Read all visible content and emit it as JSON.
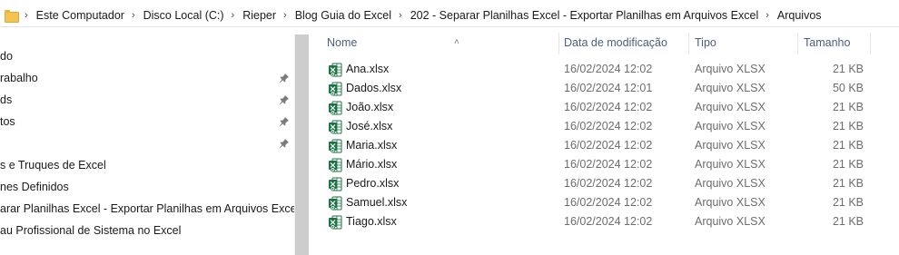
{
  "breadcrumb": [
    "Este Computador",
    "Disco Local (C:)",
    "Rieper",
    "Blog Guia do Excel",
    "202 - Separar Planilhas Excel - Exportar Planilhas em Arquivos Excel",
    "Arquivos"
  ],
  "nav": {
    "items": [
      {
        "label": "do",
        "pinned": false
      },
      {
        "label": "rabalho",
        "pinned": true
      },
      {
        "label": "ds",
        "pinned": true
      },
      {
        "label": "tos",
        "pinned": true
      },
      {
        "label": "",
        "pinned": true
      },
      {
        "label": "s e Truques de Excel",
        "pinned": false
      },
      {
        "label": "nes Definidos",
        "pinned": false
      },
      {
        "label": "arar Planilhas Excel - Exportar Planilhas em Arquivos Excel",
        "pinned": false
      },
      {
        "label": "au Profissional de Sistema no Excel",
        "pinned": false
      }
    ]
  },
  "columns": {
    "name": "Nome",
    "date": "Data de modificação",
    "type": "Tipo",
    "size": "Tamanho"
  },
  "files": [
    {
      "name": "Ana.xlsx",
      "date": "16/02/2024 12:02",
      "type": "Arquivo XLSX",
      "size": "21 KB"
    },
    {
      "name": "Dados.xlsx",
      "date": "16/02/2024 12:01",
      "type": "Arquivo XLSX",
      "size": "50 KB"
    },
    {
      "name": "João.xlsx",
      "date": "16/02/2024 12:02",
      "type": "Arquivo XLSX",
      "size": "21 KB"
    },
    {
      "name": "José.xlsx",
      "date": "16/02/2024 12:02",
      "type": "Arquivo XLSX",
      "size": "21 KB"
    },
    {
      "name": "Maria.xlsx",
      "date": "16/02/2024 12:02",
      "type": "Arquivo XLSX",
      "size": "21 KB"
    },
    {
      "name": "Mário.xlsx",
      "date": "16/02/2024 12:02",
      "type": "Arquivo XLSX",
      "size": "21 KB"
    },
    {
      "name": "Pedro.xlsx",
      "date": "16/02/2024 12:02",
      "type": "Arquivo XLSX",
      "size": "21 KB"
    },
    {
      "name": "Samuel.xlsx",
      "date": "16/02/2024 12:02",
      "type": "Arquivo XLSX",
      "size": "21 KB"
    },
    {
      "name": "Tiago.xlsx",
      "date": "16/02/2024 12:02",
      "type": "Arquivo XLSX",
      "size": "21 KB"
    }
  ],
  "icons": {
    "folder": "folder-icon",
    "pin": "pin-icon",
    "file": "excel-file-icon",
    "sort": "sort-up-icon"
  },
  "colors": {
    "excel_green": "#1e7145",
    "header_text": "#4c607a",
    "meta_text": "#6d6d6d"
  }
}
